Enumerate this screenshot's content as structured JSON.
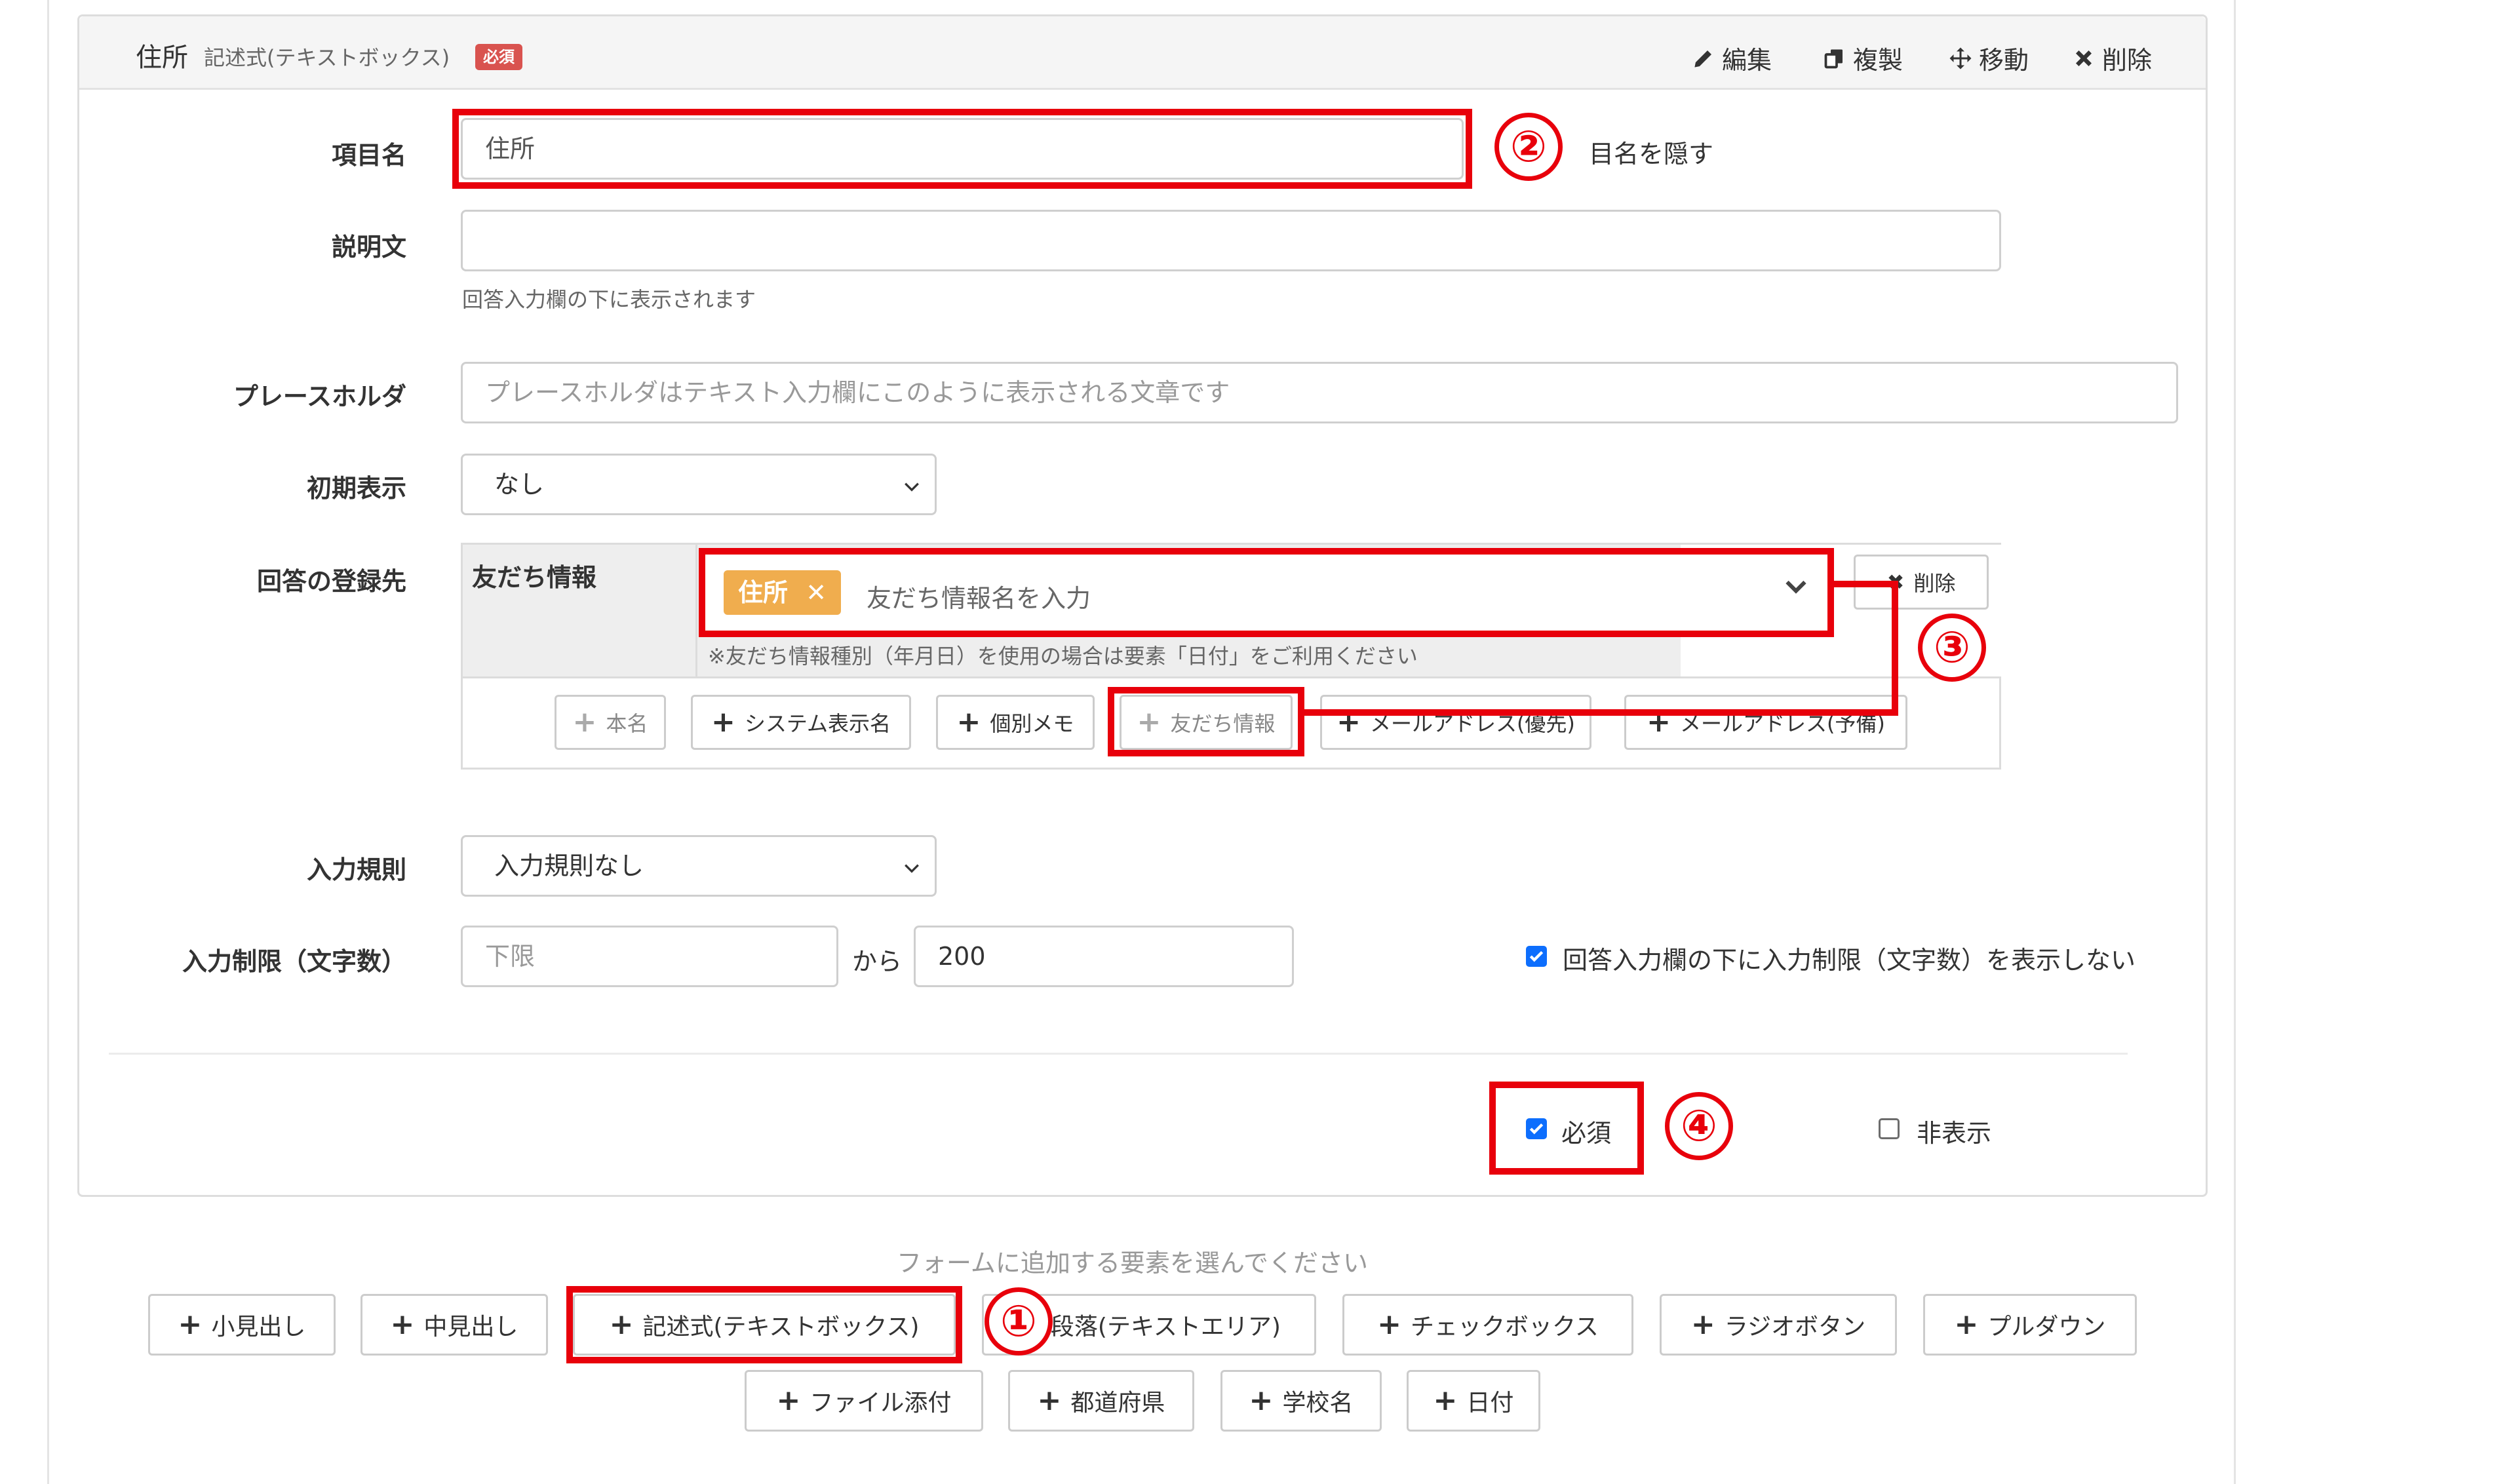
{
  "header": {
    "title": "住所",
    "type": "記述式(テキストボックス)",
    "required_badge": "必須",
    "actions": [
      {
        "label": "編集",
        "icon": "pencil-icon"
      },
      {
        "label": "複製",
        "icon": "copy-icon"
      },
      {
        "label": "移動",
        "icon": "move-icon"
      },
      {
        "label": "削除",
        "icon": "close-icon"
      }
    ]
  },
  "fields": {
    "item_name": {
      "label": "項目名",
      "value": "住所",
      "hide_label": "目名を隠す"
    },
    "description": {
      "label": "説明文",
      "value": "",
      "help": "回答入力欄の下に表示されます"
    },
    "placeholder": {
      "label": "プレースホルダ",
      "placeholder": "プレースホルダはテキスト入力欄にこのように表示される文章です"
    },
    "initial_display": {
      "label": "初期表示",
      "selected": "なし"
    },
    "answer_target": {
      "label": "回答の登録先",
      "source": "友だち情報",
      "tag": "住所",
      "input_placeholder": "友だち情報名を入力",
      "note": "※友だち情報種別（年月日）を使用の場合は要素「日付」をご利用ください",
      "delete_label": "削除",
      "buttons": [
        "本名",
        "システム表示名",
        "個別メモ",
        "友だち情報",
        "メールアドレス(優先)",
        "メールアドレス(予備)"
      ]
    },
    "input_rule": {
      "label": "入力規則",
      "selected": "入力規則なし"
    },
    "char_limit": {
      "label": "入力制限（文字数）",
      "min_placeholder": "下限",
      "from": "から",
      "max": "200",
      "hide_note": "回答入力欄の下に入力制限（文字数）を表示しない",
      "hide_note_checked": true
    }
  },
  "options": {
    "required": {
      "label": "必須",
      "checked": true
    },
    "hidden": {
      "label": "非表示",
      "checked": false
    }
  },
  "add_section": {
    "prompt": "フォームに追加する要素を選んでください",
    "row1": [
      "小見出し",
      "中見出し",
      "記述式(テキストボックス)",
      "段落(テキストエリア)",
      "チェックボックス",
      "ラジオボタン",
      "プルダウン"
    ],
    "row2": [
      "ファイル添付",
      "都道府県",
      "学校名",
      "日付"
    ]
  },
  "annotations": {
    "one": "①",
    "two": "②",
    "three": "③",
    "four": "④"
  },
  "colors": {
    "highlight": "#e8000b",
    "tag": "#f0ad4e",
    "badge": "#d9534f",
    "checkbox": "#0d6efd"
  }
}
